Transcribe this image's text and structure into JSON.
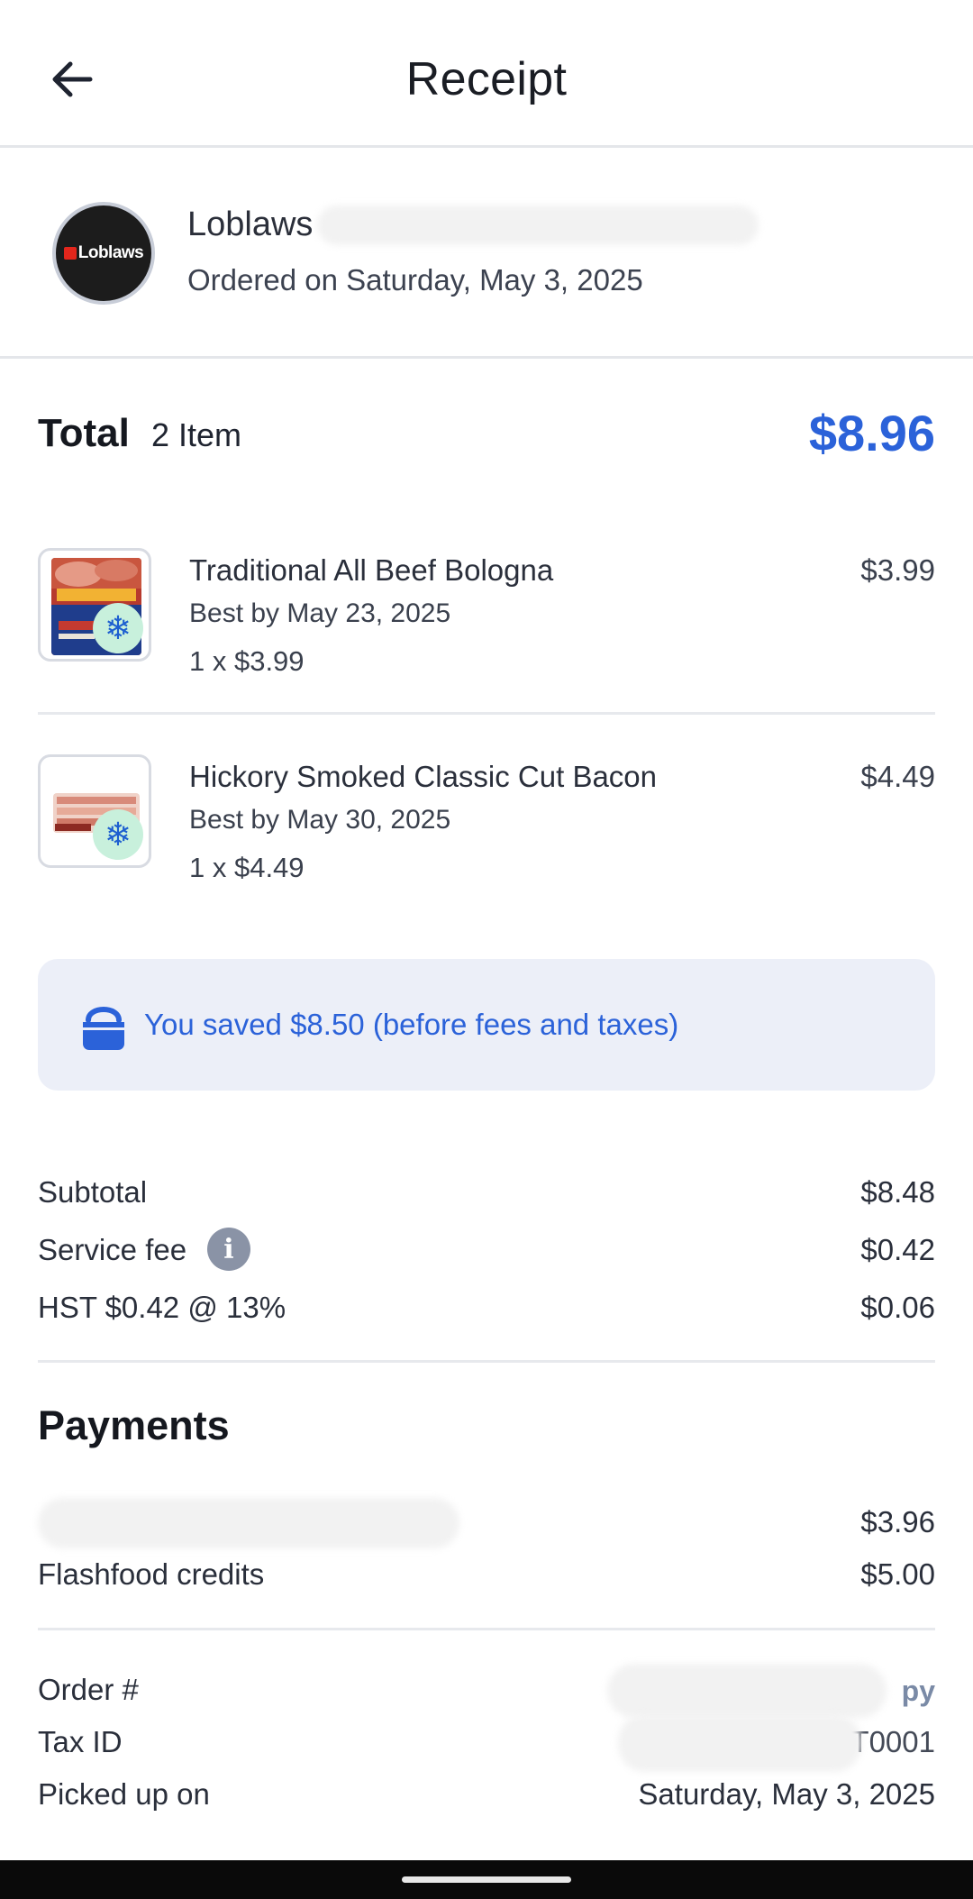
{
  "header": {
    "title": "Receipt"
  },
  "store": {
    "name": "Loblaws",
    "logo_text": "Loblaws",
    "ordered_on": "Ordered on Saturday, May 3, 2025"
  },
  "summary": {
    "total_label": "Total",
    "item_count": "2 Item",
    "total_amount": "$8.96"
  },
  "items": [
    {
      "name": "Traditional All Beef Bologna",
      "best_by": "Best by May 23, 2025",
      "quantity": "1 x $3.99",
      "price": "$3.99",
      "icon": "frozen-snowflake-icon"
    },
    {
      "name": "Hickory Smoked Classic Cut Bacon",
      "best_by": "Best by May 30, 2025",
      "quantity": "1 x $4.49",
      "price": "$4.49",
      "icon": "frozen-snowflake-icon"
    }
  ],
  "savings": {
    "text": "You saved $8.50  (before fees and taxes)",
    "icon": "shopping-bag-icon"
  },
  "fees": {
    "subtotal_label": "Subtotal",
    "subtotal_value": "$8.48",
    "service_fee_label": "Service fee",
    "service_fee_value": "$0.42",
    "hst_label": "HST $0.42 @ 13%",
    "hst_value": "$0.06",
    "info_icon_glyph": "i"
  },
  "payments": {
    "title": "Payments",
    "card_amount": "$3.96",
    "credits_label": "Flashfood credits",
    "credits_amount": "$5.00"
  },
  "order_info": {
    "order_label": "Order #",
    "copy_label": "py",
    "tax_label": "Tax ID",
    "tax_value_suffix": "RT0001",
    "picked_up_label": "Picked up on",
    "picked_up_value": "Saturday, May 3, 2025"
  },
  "colors": {
    "accent": "#2b62d9",
    "savings_bg": "#eceff8",
    "frozen_badge": "#c8f0dc",
    "divider": "#e7e9ed"
  }
}
